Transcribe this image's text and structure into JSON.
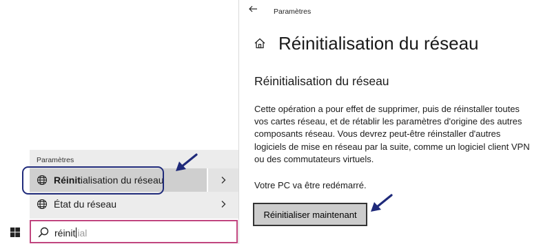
{
  "search_results": {
    "header": "Paramètres",
    "items": [
      {
        "match": "Réinit",
        "rest": "ialisation du réseau",
        "icon": "network-globe-icon",
        "selected": true
      },
      {
        "label": "État du réseau",
        "icon": "network-globe-icon",
        "selected": false
      }
    ]
  },
  "taskbar": {
    "start_icon": "windows-logo-icon",
    "search": {
      "typed": "réinit",
      "suggestion": "ial",
      "icon": "search-icon"
    }
  },
  "settings": {
    "app_title": "Paramètres",
    "page_title": "Réinitialisation du réseau",
    "section_title": "Réinitialisation du réseau",
    "description": "Cette opération a pour effet de supprimer, puis de réinstaller toutes vos cartes réseau, et de rétablir les paramètres d'origine des autres composants réseau. Vous devrez peut-être réinstaller d'autres logiciels de mise en réseau par la suite, comme un logiciel client VPN ou des commutateurs virtuels.",
    "restart_note": "Votre PC va être redémarré.",
    "reset_button": "Réinitialiser maintenant"
  },
  "colors": {
    "highlight_ring": "#1f2a7a",
    "annotation_arrow": "#1f2a7a",
    "search_border": "#c0447e",
    "panel_bg": "#ececec",
    "selected_row_bg": "#cfcfcf",
    "button_bg": "#cccccc"
  }
}
